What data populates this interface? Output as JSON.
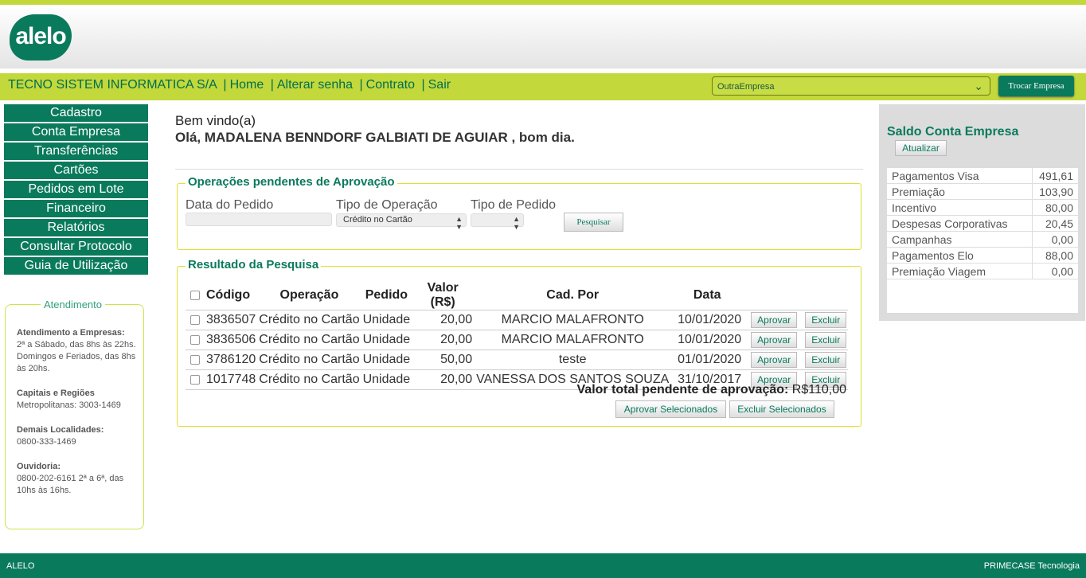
{
  "brand": {
    "logo_text": "alelo"
  },
  "nav": {
    "company": "TECNO SISTEM INFORMATICA S/A",
    "separator": "|",
    "links": [
      "Home",
      "Alterar senha",
      "Contrato",
      "Sair"
    ],
    "company_select_value": "OutraEmpresa",
    "swap_button": "Trocar Empresa"
  },
  "menu": [
    "Cadastro",
    "Conta Empresa",
    "Transferências",
    "Cartões",
    "Pedidos em Lote",
    "Financeiro",
    "Relatórios",
    "Consultar Protocolo",
    "Guia de Utilização"
  ],
  "support": {
    "title": "Atendimento",
    "sections": [
      {
        "label": "Atendimento a Empresas:",
        "text": "2ª a Sábado, das 8hs às 22hs. Domingos e Feriados, das 8hs às 20hs."
      },
      {
        "label": "Capitais e Regiões",
        "text": "Metropolitanas: 3003-1469"
      },
      {
        "label": "Demais Localidades:",
        "text": "0800-333-1469"
      },
      {
        "label": "Ouvidoria:",
        "text": "0800-202-6161 2ª a 6ª, das 10hs às 16hs."
      }
    ]
  },
  "welcome": {
    "line1": "Bem vindo(a)",
    "line2": "Olá, MADALENA BENNDORF GALBIATI DE AGUIAR , bom dia."
  },
  "pending": {
    "title": "Operações pendentes de Aprovação",
    "date_label": "Data do Pedido",
    "date_value": "",
    "op_type_label": "Tipo de Operação",
    "op_type_value": "Crédito no Cartão",
    "order_type_label": "Tipo de Pedido",
    "order_type_value": "",
    "search_button": "Pesquisar"
  },
  "results": {
    "title": "Resultado da Pesquisa",
    "headers": [
      "Código",
      "Operação",
      "Pedido",
      "Valor (R$)",
      "Cad. Por",
      "Data"
    ],
    "approve_label": "Aprovar",
    "delete_label": "Excluir",
    "rows": [
      {
        "code": "3836507",
        "operation": "Crédito no Cartão",
        "order": "Unidade",
        "value": "20,00",
        "by": "MARCIO MALAFRONTO",
        "date": "10/01/2020"
      },
      {
        "code": "3836506",
        "operation": "Crédito no Cartão",
        "order": "Unidade",
        "value": "20,00",
        "by": "MARCIO MALAFRONTO",
        "date": "10/01/2020"
      },
      {
        "code": "3786120",
        "operation": "Crédito no Cartão",
        "order": "Unidade",
        "value": "50,00",
        "by": "teste",
        "date": "01/01/2020"
      },
      {
        "code": "1017748",
        "operation": "Crédito no Cartão",
        "order": "Unidade",
        "value": "20,00",
        "by": "VANESSA DOS SANTOS SOUZA",
        "date": "31/10/2017"
      }
    ],
    "total_label": "Valor total pendente de aprovação:",
    "total_value": "R$110,00",
    "approve_selected": "Aprovar Selecionados",
    "delete_selected": "Excluir Selecionados"
  },
  "balance": {
    "title": "Saldo Conta Empresa",
    "refresh": "Atualizar",
    "items": [
      {
        "label": "Pagamentos Visa",
        "value": "491,61"
      },
      {
        "label": "Premiação",
        "value": "103,90"
      },
      {
        "label": "Incentivo",
        "value": "80,00"
      },
      {
        "label": "Despesas Corporativas",
        "value": "20,45"
      },
      {
        "label": "Campanhas",
        "value": "0,00"
      },
      {
        "label": "Pagamentos Elo",
        "value": "88,00"
      },
      {
        "label": "Premiação Viagem",
        "value": "0,00"
      }
    ]
  },
  "footer": {
    "left": "ALELO",
    "right": "PRIMECASE Tecnologia"
  },
  "colors": {
    "brand_green": "#0a7a5c",
    "lime": "#c3d83a",
    "border_yellow": "#e1df2f"
  }
}
